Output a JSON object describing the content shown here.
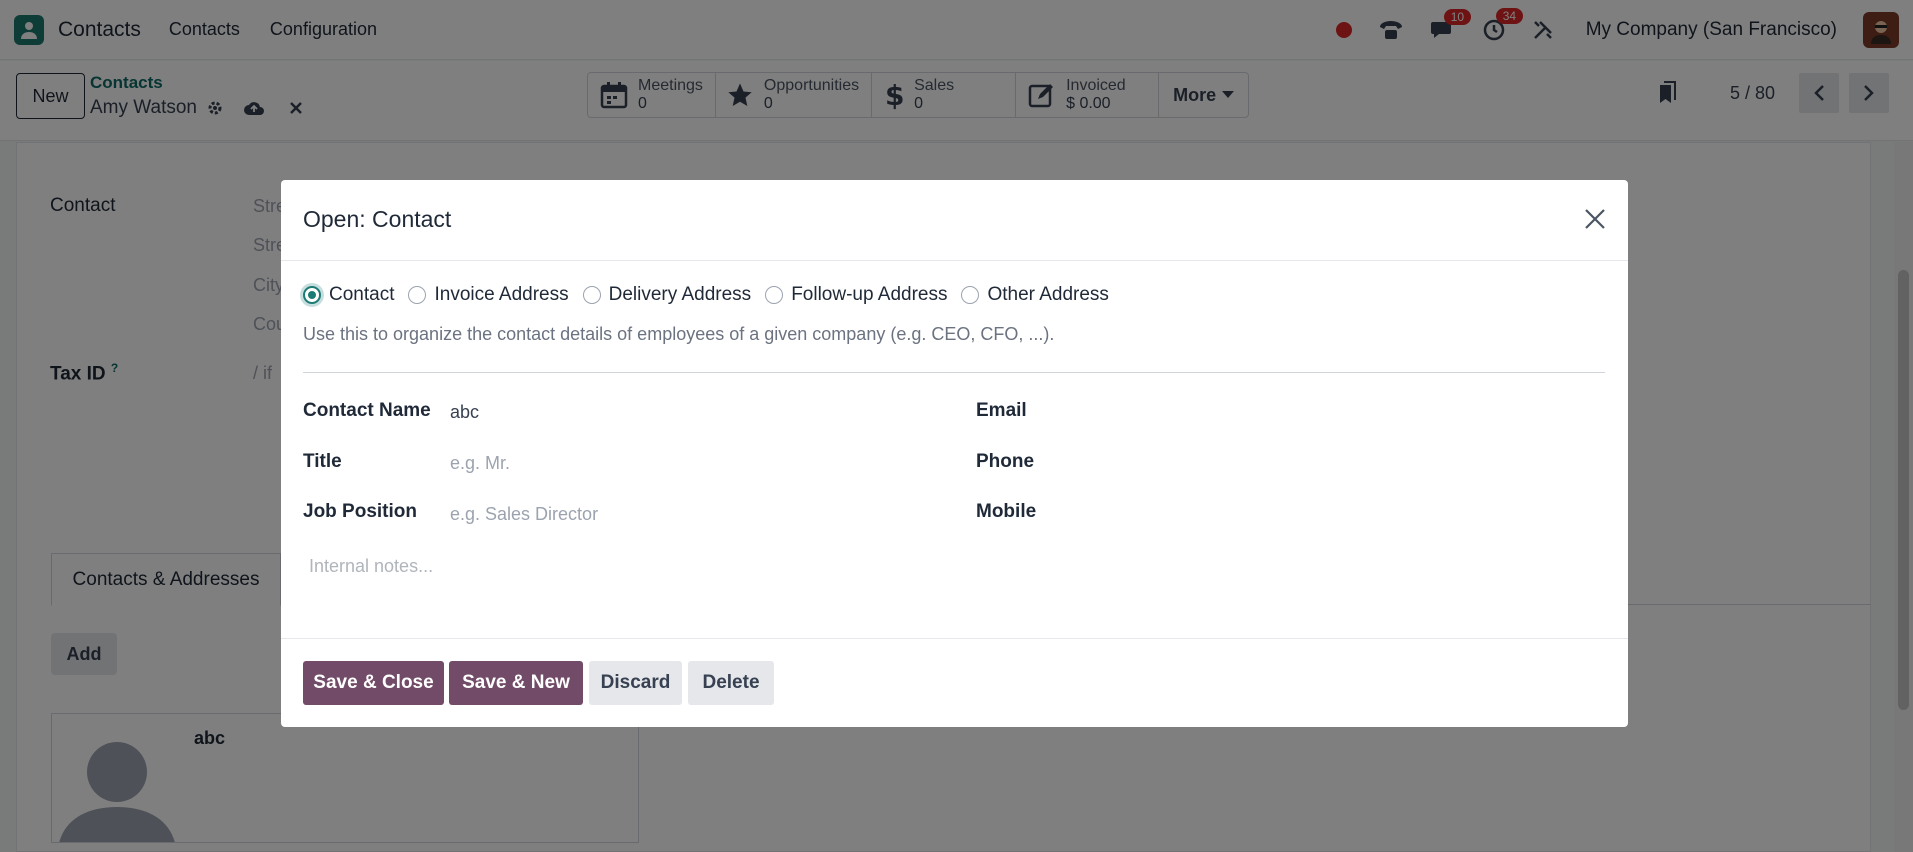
{
  "navbar": {
    "app_name": "Contacts",
    "menu": [
      "Contacts",
      "Configuration"
    ],
    "chat_badge": "10",
    "activity_badge": "34",
    "company": "My Company (San Francisco)"
  },
  "control": {
    "new_label": "New",
    "breadcrumb_parent": "Contacts",
    "record_name": "Amy Watson",
    "smart_buttons": [
      {
        "label": "Meetings",
        "value": "0",
        "icon": "calendar-icon"
      },
      {
        "label": "Opportunities",
        "value": "0",
        "icon": "star-icon"
      },
      {
        "label": "Sales",
        "value": "0",
        "icon": "dollar-icon"
      },
      {
        "label": "Invoiced",
        "value": "$ 0.00",
        "icon": "edit-icon"
      }
    ],
    "more_label": "More",
    "pager": "5 / 80"
  },
  "background_form": {
    "contact_label": "Contact",
    "address_placeholders": [
      "Stre",
      "Stre",
      "City",
      "Cou"
    ],
    "tax_label": "Tax ID",
    "tax_help": "?",
    "tax_placeholder": "/ if",
    "tab_label": "Contacts & Addresses",
    "add_label": "Add",
    "card_name": "abc"
  },
  "modal": {
    "title": "Open: Contact",
    "radio_options": [
      "Contact",
      "Invoice Address",
      "Delivery Address",
      "Follow-up Address",
      "Other Address"
    ],
    "selected_option": "Contact",
    "help_text": "Use this to organize the contact details of employees of a given company (e.g. CEO, CFO, ...).",
    "contact_name_label": "Contact Name",
    "contact_name_value": "abc",
    "title_label": "Title",
    "title_placeholder": "e.g. Mr.",
    "job_label": "Job Position",
    "job_placeholder": "e.g. Sales Director",
    "email_label": "Email",
    "phone_label": "Phone",
    "mobile_label": "Mobile",
    "notes_placeholder": "Internal notes...",
    "buttons": {
      "save_close": "Save & Close",
      "save_new": "Save & New",
      "discard": "Discard",
      "delete": "Delete"
    }
  },
  "colors": {
    "primary": "#714b67",
    "accent": "#1d7b76",
    "badge": "#dc2626"
  }
}
